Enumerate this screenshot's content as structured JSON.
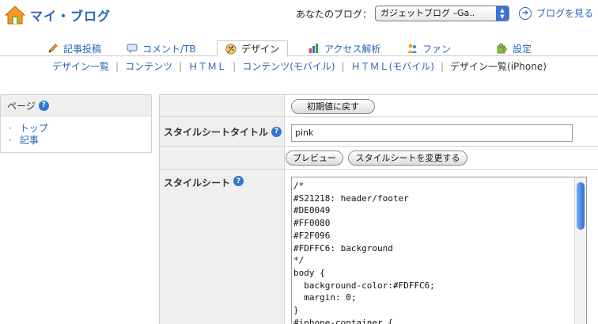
{
  "header": {
    "title": "マイ・ブログ",
    "blog_label": "あなたのブログ：",
    "blog_selected": "ガジェットブログ –Ga..",
    "view_blog": "ブログを見る"
  },
  "tabs": [
    {
      "label": "記事投稿",
      "icon": "pencil-icon"
    },
    {
      "label": "コメント/TB",
      "icon": "comment-icon"
    },
    {
      "label": "デザイン",
      "icon": "palette-icon",
      "active": true
    },
    {
      "label": "アクセス解析",
      "icon": "bar-chart-icon"
    },
    {
      "label": "ファン",
      "icon": "fans-icon"
    },
    {
      "label": "設定",
      "icon": "puzzle-icon"
    }
  ],
  "subnav": [
    {
      "label": "デザイン一覧"
    },
    {
      "label": "コンテンツ"
    },
    {
      "label": "ＨＴＭＬ"
    },
    {
      "label": "コンテンツ(モバイル)"
    },
    {
      "label": "ＨＴＭＬ(モバイル)"
    },
    {
      "label": "デザイン一覧(iPhone)",
      "current": true
    }
  ],
  "sidebar": {
    "heading": "ページ",
    "items": [
      "トップ",
      "記事"
    ]
  },
  "form": {
    "reset_button": "初期値に戻す",
    "title_label": "スタイルシートタイトル",
    "title_value": "pink",
    "preview_button": "プレビュー",
    "change_button": "スタイルシートを変更する",
    "stylesheet_label": "スタイルシート",
    "stylesheet_content": "/*\n#S21218: header/footer\n#DE0049\n#FF0080\n#F2F096\n#FDFFC6: background\n*/\nbody {\n  background-color:#FDFFC6;\n  margin: 0;\n}\n#iphone-container {"
  },
  "colors": {
    "link": "#2a63b8",
    "help_icon": "#2f78d0",
    "label_bg": "#efefef",
    "scroll_thumb": "#2f6fd8"
  }
}
